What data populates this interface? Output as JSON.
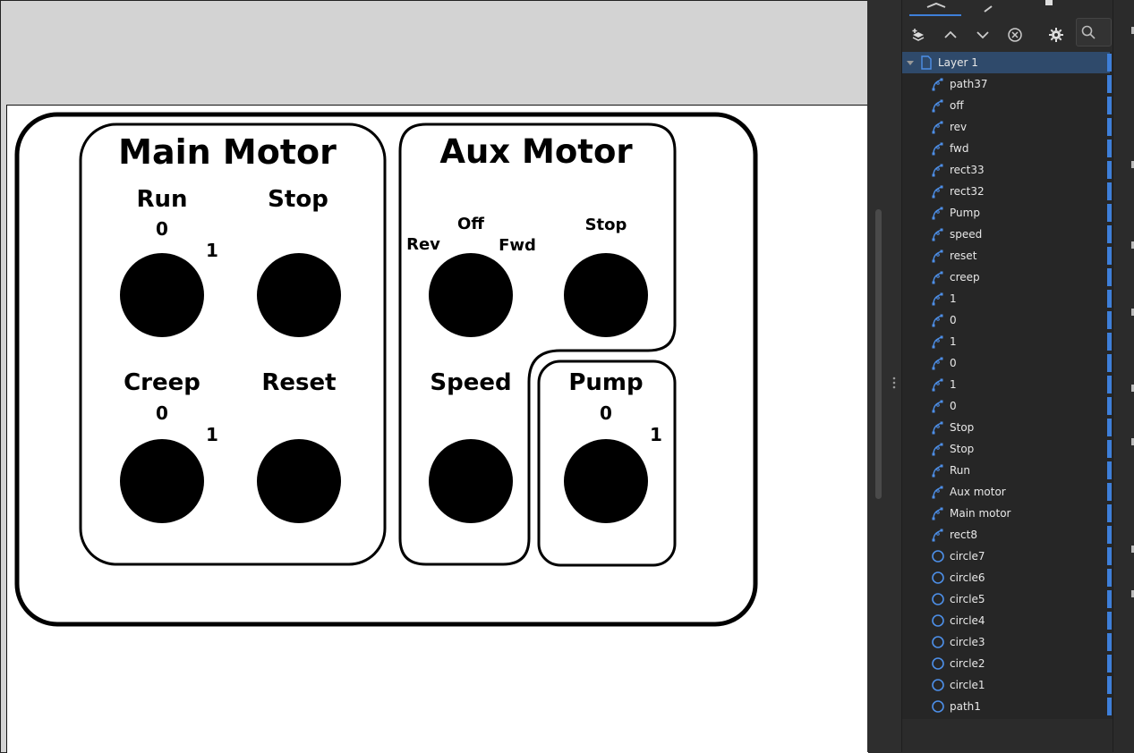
{
  "drawing": {
    "main_title": "Main Motor",
    "aux_title": "Aux Motor",
    "run_label": "Run",
    "stop_label_main": "Stop",
    "creep_label": "Creep",
    "reset_label": "Reset",
    "off_label": "Off",
    "rev_label": "Rev",
    "fwd_label": "Fwd",
    "stop_label_aux": "Stop",
    "speed_label": "Speed",
    "pump_label": "Pump",
    "run_zero": "0",
    "run_one": "1",
    "creep_zero": "0",
    "creep_one": "1",
    "pump_zero": "0",
    "pump_one": "1"
  },
  "panel": {
    "layer_name": "Layer 1",
    "items": [
      {
        "label": "path37",
        "icon": "path-icon"
      },
      {
        "label": "off",
        "icon": "path-icon"
      },
      {
        "label": "rev",
        "icon": "path-icon"
      },
      {
        "label": "fwd",
        "icon": "path-icon"
      },
      {
        "label": "rect33",
        "icon": "path-icon"
      },
      {
        "label": "rect32",
        "icon": "path-icon"
      },
      {
        "label": "Pump",
        "icon": "path-icon"
      },
      {
        "label": "speed",
        "icon": "path-icon"
      },
      {
        "label": "reset",
        "icon": "path-icon"
      },
      {
        "label": "creep",
        "icon": "path-icon"
      },
      {
        "label": "1",
        "icon": "path-icon"
      },
      {
        "label": "0",
        "icon": "path-icon"
      },
      {
        "label": "1",
        "icon": "path-icon"
      },
      {
        "label": "0",
        "icon": "path-icon"
      },
      {
        "label": "1",
        "icon": "path-icon"
      },
      {
        "label": "0",
        "icon": "path-icon"
      },
      {
        "label": "Stop",
        "icon": "path-icon"
      },
      {
        "label": "Stop",
        "icon": "path-icon"
      },
      {
        "label": "Run",
        "icon": "path-icon"
      },
      {
        "label": "Aux motor",
        "icon": "path-icon"
      },
      {
        "label": "Main motor",
        "icon": "path-icon"
      },
      {
        "label": "rect8",
        "icon": "path-icon"
      },
      {
        "label": "circle7",
        "icon": "circle-icon"
      },
      {
        "label": "circle6",
        "icon": "circle-icon"
      },
      {
        "label": "circle5",
        "icon": "circle-icon"
      },
      {
        "label": "circle4",
        "icon": "circle-icon"
      },
      {
        "label": "circle3",
        "icon": "circle-icon"
      },
      {
        "label": "circle2",
        "icon": "circle-icon"
      },
      {
        "label": "circle1",
        "icon": "circle-icon"
      },
      {
        "label": "path1",
        "icon": "circle-icon"
      }
    ]
  },
  "colors": {
    "accent": "#3e7fd9",
    "selected_row": "#2f4a6b",
    "panel_bg": "#2b2b2b",
    "canvas_bg": "#d3d3d3"
  }
}
